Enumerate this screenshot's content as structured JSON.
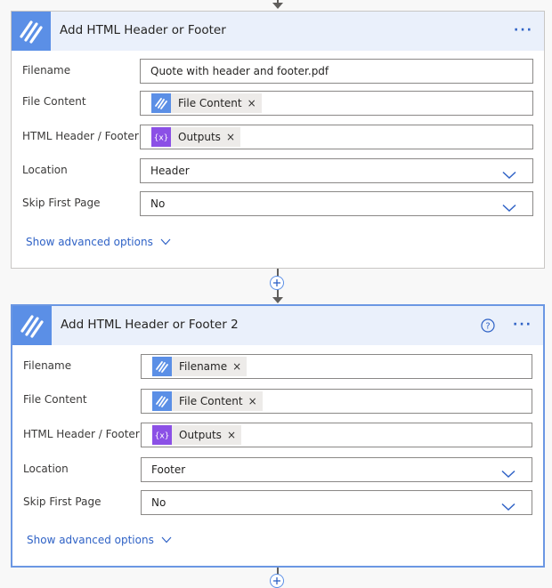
{
  "card1": {
    "title": "Add HTML Header or Footer",
    "more_label": "···",
    "fields": {
      "filename": {
        "label": "Filename",
        "value": "Quote with header and footer.pdf"
      },
      "file_content": {
        "label": "File Content",
        "token": "File Content",
        "token_icon": "encodian-icon"
      },
      "html_header_footer": {
        "label": "HTML Header / Footer",
        "token": "Outputs",
        "token_icon": "variable-icon"
      },
      "location": {
        "label": "Location",
        "value": "Header"
      },
      "skip_first_page": {
        "label": "Skip First Page",
        "value": "No"
      }
    },
    "advanced_label": "Show advanced options"
  },
  "card2": {
    "title": "Add HTML Header or Footer 2",
    "more_label": "···",
    "fields": {
      "filename": {
        "label": "Filename",
        "token": "Filename",
        "token_icon": "encodian-icon"
      },
      "file_content": {
        "label": "File Content",
        "token": "File Content",
        "token_icon": "encodian-icon"
      },
      "html_header_footer": {
        "label": "HTML Header / Footer",
        "token": "Outputs",
        "token_icon": "variable-icon"
      },
      "location": {
        "label": "Location",
        "value": "Footer"
      },
      "skip_first_page": {
        "label": "Skip First Page",
        "value": "No"
      }
    },
    "advanced_label": "Show advanced options"
  },
  "token_remove_glyph": "×",
  "colors": {
    "accent": "#2f62c6",
    "header_bg": "#eaf0fb",
    "action_icon_bg": "#5b8fe6",
    "variable_token_bg": "#8b50e6",
    "selected_border": "#6b97e3"
  }
}
